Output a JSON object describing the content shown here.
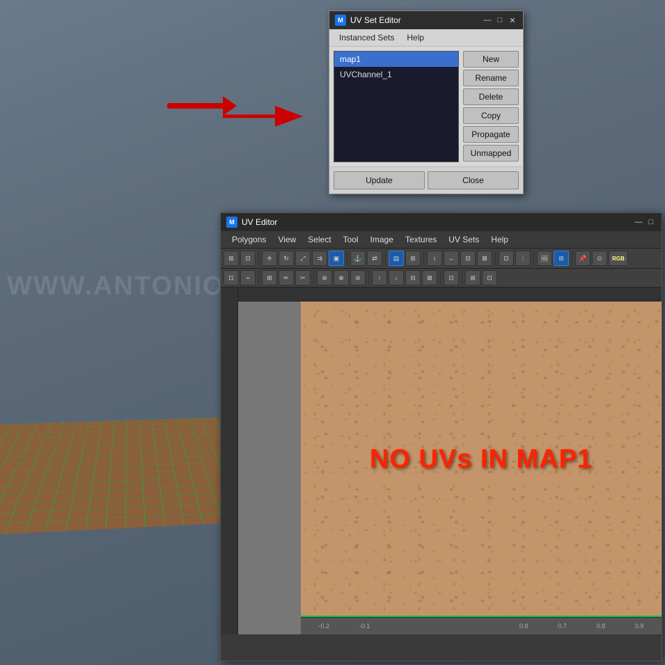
{
  "viewport": {
    "watermark": "WWW.ANTONIOBOSI.COM"
  },
  "uv_set_editor": {
    "title": "UV Set Editor",
    "icon": "M",
    "menus": [
      "Instanced Sets",
      "Help"
    ],
    "uv_list": [
      {
        "name": "map1",
        "selected": true
      },
      {
        "name": "UVChannel_1",
        "selected": false
      }
    ],
    "buttons": {
      "new": "New",
      "rename": "Rename",
      "delete": "Delete",
      "copy": "Copy",
      "propagate": "Propagate",
      "unmapped": "Unmapped"
    },
    "footer": {
      "update": "Update",
      "close": "Close"
    },
    "window_controls": {
      "minimize": "—",
      "maximize": "□",
      "close": "✕"
    }
  },
  "uv_editor": {
    "title": "UV Editor",
    "icon": "M",
    "menus": [
      "Polygons",
      "View",
      "Select",
      "Tool",
      "Image",
      "Textures",
      "UV Sets",
      "Help"
    ],
    "no_uvs_text": "NO UVs IN MAP1",
    "window_controls": {
      "minimize": "—",
      "maximize": "□"
    },
    "ruler_labels": [
      "-0.2",
      "-0.1",
      "",
      "",
      "",
      "",
      "0.8",
      "0.7",
      "0.8",
      "0.9"
    ]
  },
  "arrows": {
    "arrow1_label": "red arrow pointing to UV Set Editor",
    "arrow2_label": "red arrow pointing to UV Editor"
  }
}
